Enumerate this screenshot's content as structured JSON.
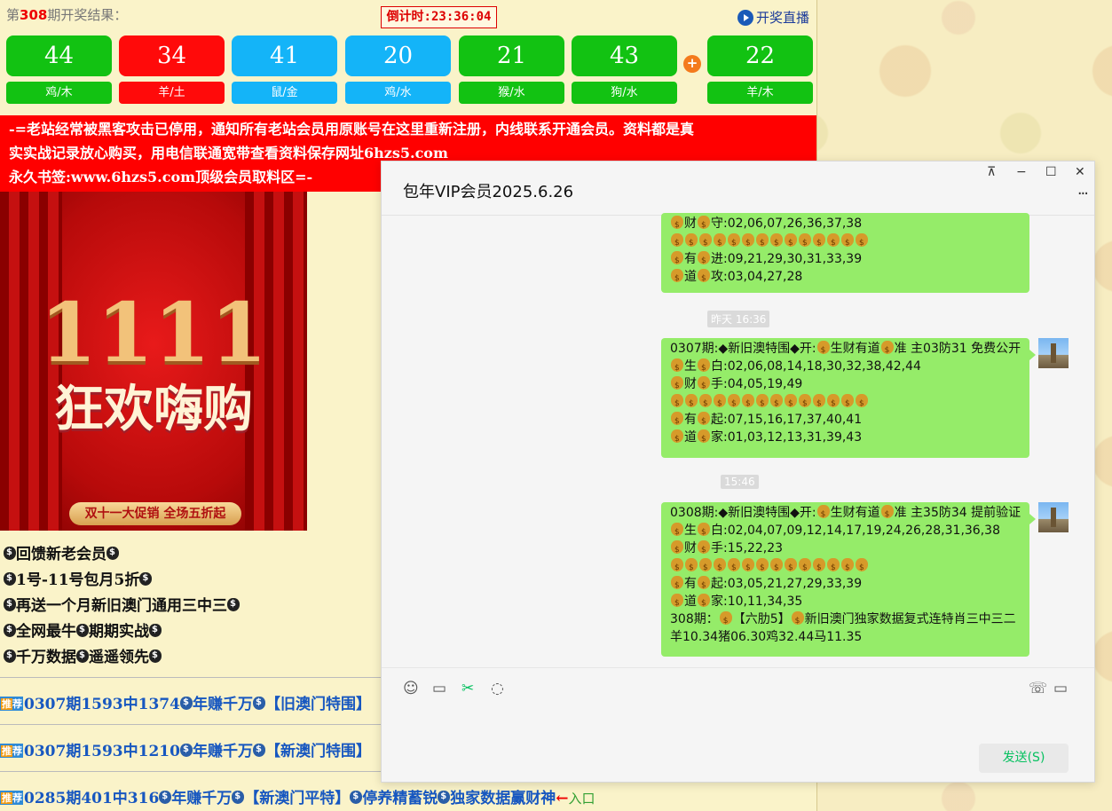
{
  "draw": {
    "prefix": "第",
    "period": "308",
    "suffix": "期开奖结果：",
    "countdown": "倒计时:23:36:04",
    "live_label": "开奖直播",
    "balls": [
      {
        "n": "44",
        "z": "鸡/木",
        "c": "g"
      },
      {
        "n": "34",
        "z": "羊/土",
        "c": "r"
      },
      {
        "n": "41",
        "z": "鼠/金",
        "c": "b"
      },
      {
        "n": "20",
        "z": "鸡/水",
        "c": "b"
      },
      {
        "n": "21",
        "z": "猴/水",
        "c": "g"
      },
      {
        "n": "43",
        "z": "狗/水",
        "c": "g"
      }
    ],
    "special": {
      "n": "22",
      "z": "羊/木",
      "c": "g"
    },
    "plus": "+"
  },
  "notice": [
    "-=老站经常被黑客攻击已停用，通知所有老站会员用原账号在这里重新注册，内线联系开通会员。资料都是真",
    "实实战记录放心购买，用电信联通宽带查看资料保存网址6hzs5.com",
    "永久书签:www.6hzs5.com顶级会员取料区=-"
  ],
  "banner": {
    "big": "1111",
    "title": "狂欢嗨购",
    "ribbon": "双十一大促销 全场五折起"
  },
  "promo": [
    "回馈新老会员",
    "1号-11号包月5折",
    "再送一个月新旧澳门通用三中三"
  ],
  "promo_b": [
    [
      "全网最牛",
      "期期实战"
    ],
    [
      "千万数据",
      "遥遥领先"
    ]
  ],
  "recs": [
    {
      "tag1": "推",
      "tag2": "荐",
      "a": "0307期1593中1374",
      "b": "年赚千万",
      "c": "【旧澳门特围】"
    },
    {
      "tag1": "推",
      "tag2": "荐",
      "a": "0307期1593中1210",
      "b": "年赚千万",
      "c": "【新澳门特围】"
    },
    {
      "tag1": "推",
      "tag2": "荐",
      "a": "0285期401中316",
      "b": "年赚千万",
      "c": "【新澳门平特】",
      "d": "停养精蓄锐",
      "e": "独家数据赢财神",
      "f": "入口"
    }
  ],
  "chat": {
    "title": "包年VIP会员2025.6.26",
    "win_controls": [
      "⊼",
      "−",
      "☐",
      "✕"
    ],
    "more": "···",
    "send_label": "发送(S)",
    "b1": [
      {
        "k": "财",
        "v": "守:02,06,07,26,36,37,38"
      },
      {
        "row": 14
      },
      {
        "k": "有",
        "v": "进:09,21,29,30,31,33,39"
      },
      {
        "k": "道",
        "v": "攻:03,04,27,28"
      }
    ],
    "t1": "昨天 16:36",
    "b2": {
      "head": "0307期:◆新旧澳特围◆开:",
      "head2": "生财有道",
      "head3": "准  主03防31 免费公开",
      "lines": [
        {
          "k": "生",
          "v": "白:02,06,08,14,18,30,32,38,42,44"
        },
        {
          "k": "财",
          "v": "手:04,05,19,49"
        },
        {
          "row": 14
        },
        {
          "k": "有",
          "v": "起:07,15,16,17,37,40,41"
        },
        {
          "k": "道",
          "v": "家:01,03,12,13,31,39,43"
        }
      ]
    },
    "t2": "15:46",
    "b3": {
      "head": "0308期:◆新旧澳特围◆开:",
      "head2": "生财有道",
      "head3": "准  主35防34 提前验证",
      "lines": [
        {
          "k": "生",
          "v": "白:02,04,07,09,12,14,17,19,24,26,28,31,36,38"
        },
        {
          "k": "财",
          "v": "手:15,22,23"
        },
        {
          "row": 14
        },
        {
          "k": "有",
          "v": "起:03,05,21,27,29,33,39"
        },
        {
          "k": "道",
          "v": "家:10,11,34,35"
        }
      ],
      "tail1a": "308期：",
      "tail1b": "【六肋5】",
      "tail1c": "新旧澳门独家数据复式连特肖三中三二",
      "tail2": "羊10.34猪06.30鸡32.44马11.35"
    }
  }
}
